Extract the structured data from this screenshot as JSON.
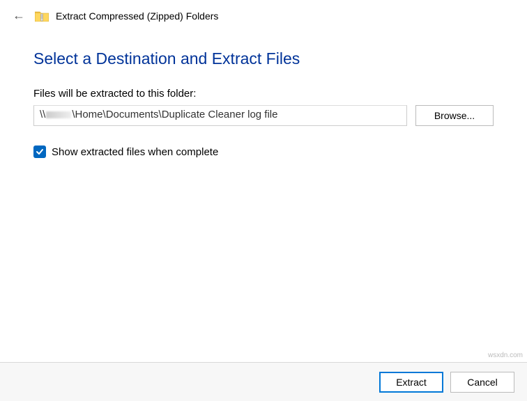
{
  "header": {
    "window_title": "Extract Compressed (Zipped) Folders"
  },
  "main": {
    "heading": "Select a Destination and Extract Files",
    "path_label": "Files will be extracted to this folder:",
    "path_prefix": "\\\\",
    "path_value": "\\Home\\Documents\\Duplicate Cleaner log file",
    "browse_label": "Browse...",
    "checkbox_checked": true,
    "checkbox_label": "Show extracted files when complete"
  },
  "footer": {
    "extract_label": "Extract",
    "cancel_label": "Cancel"
  },
  "watermark": "wsxdn.com"
}
